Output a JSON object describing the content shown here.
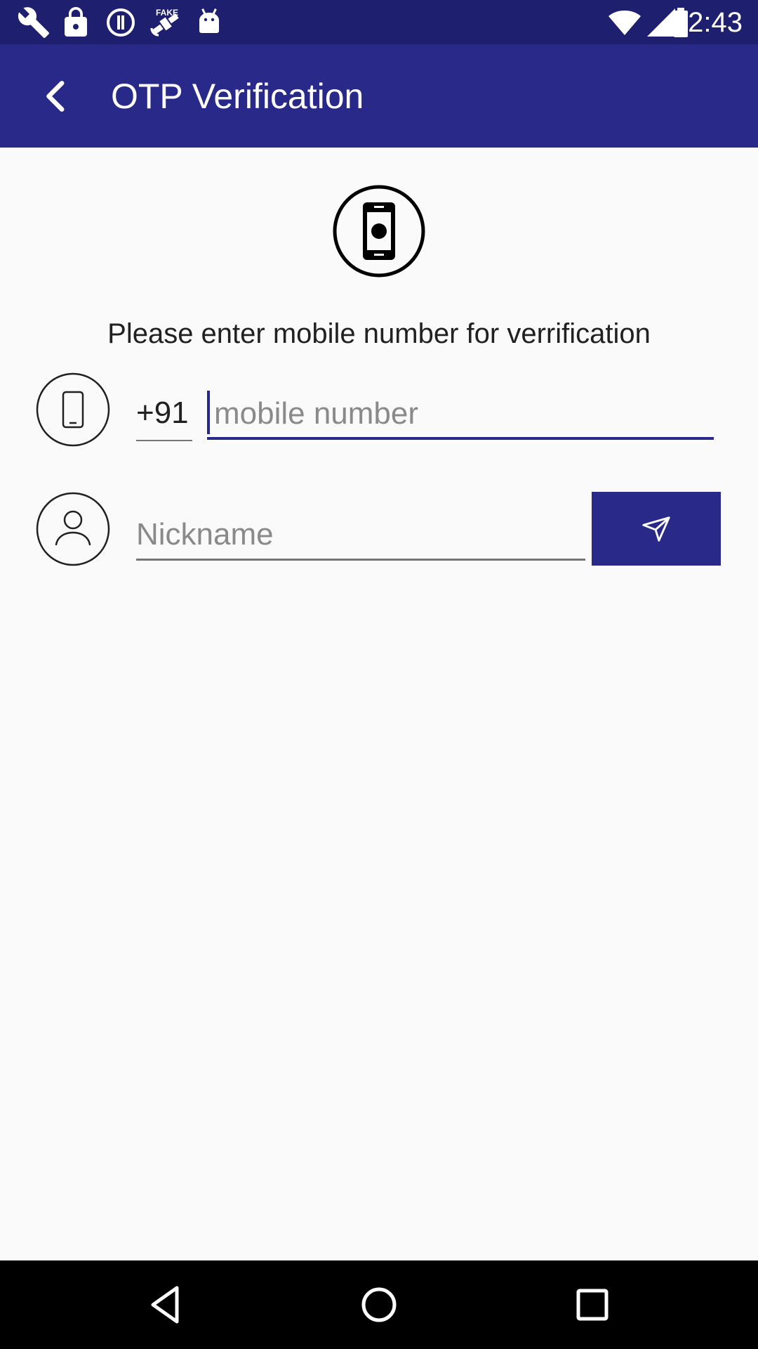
{
  "status_bar": {
    "time": "2:43",
    "left_icons": [
      "wrench-icon",
      "lock-icon",
      "info-icon",
      "fake-gps-satellite-icon",
      "android-icon"
    ],
    "fake_gps_label": "FAKE",
    "right_icons": [
      "wifi-icon",
      "signal-icon",
      "battery-icon"
    ]
  },
  "app_bar": {
    "title": "OTP Verification",
    "back_icon": "arrow-back-icon"
  },
  "hero": {
    "icon": "smartphone-icon"
  },
  "form": {
    "prompt": "Please enter mobile number for verrification",
    "country_code": "+91",
    "mobile_placeholder": "mobile number",
    "mobile_value": "",
    "nickname_placeholder": "Nickname",
    "nickname_value": "",
    "phone_icon": "phone-icon",
    "person_icon": "person-icon",
    "send_icon": "send-icon"
  },
  "nav_bar": {
    "buttons": [
      "back-triangle-icon",
      "home-circle-icon",
      "recents-square-icon"
    ]
  },
  "colors": {
    "primary": "#29298a",
    "status_bar": "#1f1f70",
    "background": "#fafafa"
  }
}
